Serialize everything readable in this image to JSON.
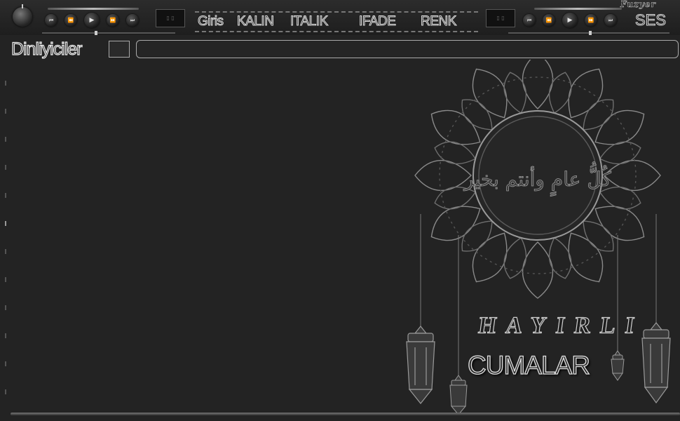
{
  "brand": "Fuzyer",
  "toolbar": {
    "format_buttons": [
      "Giris",
      "KALIN",
      "ITALIK",
      "IFADE",
      "RENK"
    ],
    "volume_label": "SES"
  },
  "player_left": {
    "controls": [
      "prev-track",
      "rewind",
      "play",
      "forward",
      "next-track"
    ]
  },
  "player_right": {
    "controls": [
      "prev-track",
      "rewind",
      "play",
      "forward",
      "next-track"
    ]
  },
  "sidebar": {
    "listeners_label": "Dinliyiciler"
  },
  "message_input": {
    "value": "",
    "placeholder": ""
  },
  "background_art": {
    "calligraphy": "كُلُّ عامٍ وأنتم بخير",
    "line1": "HAYIRLI",
    "line2": "CUMALAR"
  },
  "colors": {
    "background": "#232323",
    "text_outline": "#dddddd",
    "ornament": "#8a8a8a"
  }
}
